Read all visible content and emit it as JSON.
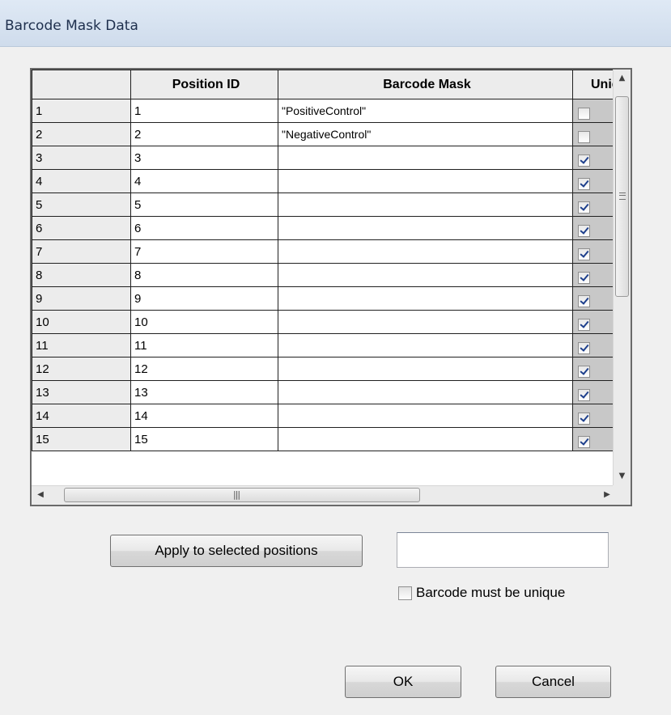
{
  "window": {
    "title": "Barcode Mask Data"
  },
  "grid": {
    "columns": [
      "",
      "Position ID",
      "Barcode Mask",
      "Uniq"
    ],
    "rows": [
      {
        "num": "1",
        "position_id": "1",
        "mask": "\"PositiveControl\"",
        "unique": false
      },
      {
        "num": "2",
        "position_id": "2",
        "mask": "\"NegativeControl\"",
        "unique": false
      },
      {
        "num": "3",
        "position_id": "3",
        "mask": "",
        "unique": true
      },
      {
        "num": "4",
        "position_id": "4",
        "mask": "",
        "unique": true
      },
      {
        "num": "5",
        "position_id": "5",
        "mask": "",
        "unique": true
      },
      {
        "num": "6",
        "position_id": "6",
        "mask": "",
        "unique": true
      },
      {
        "num": "7",
        "position_id": "7",
        "mask": "",
        "unique": true
      },
      {
        "num": "8",
        "position_id": "8",
        "mask": "",
        "unique": true
      },
      {
        "num": "9",
        "position_id": "9",
        "mask": "",
        "unique": true
      },
      {
        "num": "10",
        "position_id": "10",
        "mask": "",
        "unique": true
      },
      {
        "num": "11",
        "position_id": "11",
        "mask": "",
        "unique": true
      },
      {
        "num": "12",
        "position_id": "12",
        "mask": "",
        "unique": true
      },
      {
        "num": "13",
        "position_id": "13",
        "mask": "",
        "unique": true
      },
      {
        "num": "14",
        "position_id": "14",
        "mask": "",
        "unique": true
      },
      {
        "num": "15",
        "position_id": "15",
        "mask": "",
        "unique": true
      }
    ]
  },
  "scrollbars": {
    "up_icon": "scroll-up-arrow",
    "down_icon": "scroll-down-arrow",
    "left_icon": "scroll-left-arrow",
    "right_icon": "scroll-right-arrow"
  },
  "controls": {
    "apply_button": "Apply to selected positions",
    "apply_value": "",
    "unique_label": "Barcode must be unique",
    "unique_checked": false,
    "ok_button": "OK",
    "cancel_button": "Cancel"
  }
}
